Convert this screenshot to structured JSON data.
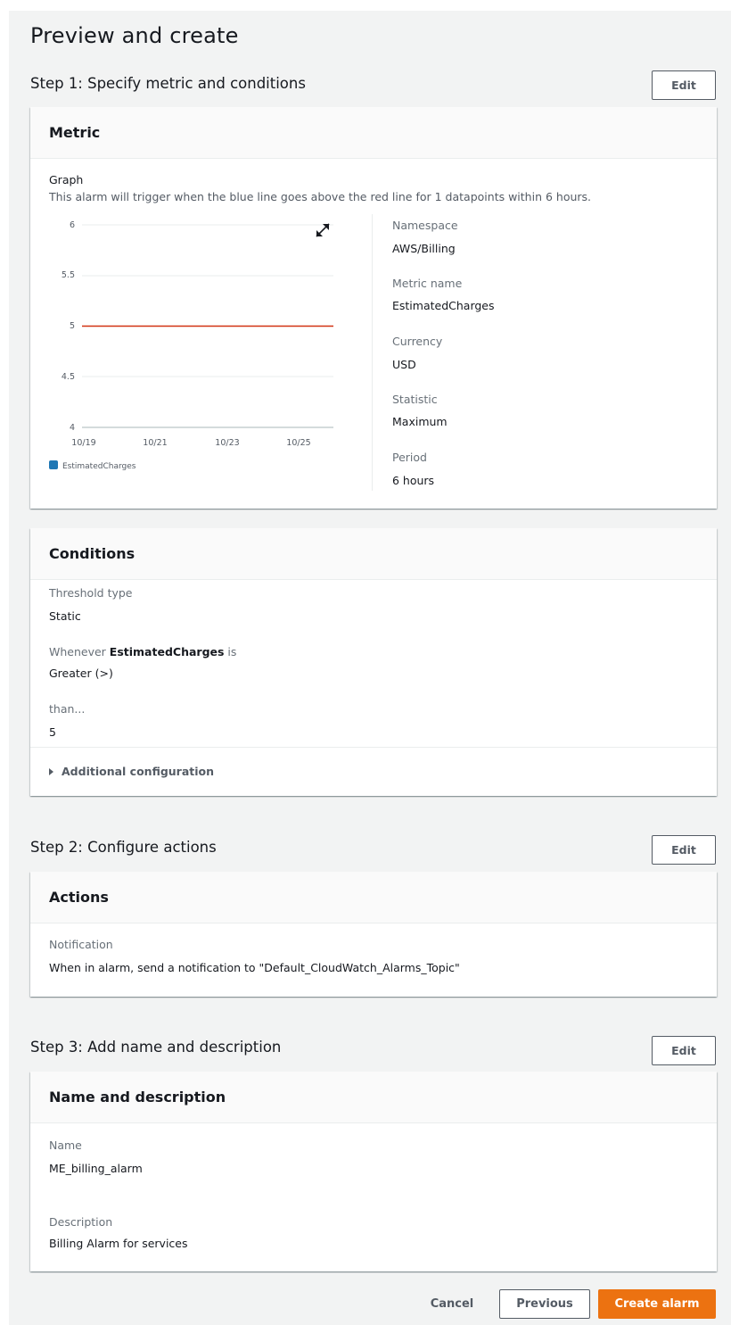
{
  "page": {
    "title": "Preview and create"
  },
  "step1": {
    "title": "Step 1: Specify metric and conditions",
    "edit_label": "Edit",
    "metric": {
      "heading": "Metric",
      "graph_label": "Graph",
      "graph_desc": "This alarm will trigger when the blue line goes above the red line for 1 datapoints within 6 hours.",
      "details": [
        {
          "label": "Namespace",
          "value": "AWS/Billing"
        },
        {
          "label": "Metric name",
          "value": "EstimatedCharges"
        },
        {
          "label": "Currency",
          "value": "USD"
        },
        {
          "label": "Statistic",
          "value": "Maximum"
        },
        {
          "label": "Period",
          "value": "6 hours"
        }
      ]
    },
    "conditions": {
      "heading": "Conditions",
      "threshold_type_label": "Threshold type",
      "threshold_type_value": "Static",
      "whenever_prefix": "Whenever ",
      "whenever_metric": "EstimatedCharges",
      "whenever_suffix": " is",
      "operator_value": "Greater (>)",
      "than_label": "than...",
      "than_value": "5",
      "additional_config": "Additional configuration"
    }
  },
  "chart_data": {
    "type": "line",
    "x_ticks": [
      "10/19",
      "10/21",
      "10/23",
      "10/25"
    ],
    "y_ticks": [
      "6",
      "5.5",
      "5",
      "4.5",
      "4"
    ],
    "ylim": [
      4,
      6
    ],
    "threshold": 5,
    "series": [
      {
        "name": "EstimatedCharges",
        "color": "#1f77b4",
        "values": []
      }
    ],
    "threshold_color": "#d13212",
    "legend_position": "bottom-left"
  },
  "step2": {
    "title": "Step 2: Configure actions",
    "edit_label": "Edit",
    "heading": "Actions",
    "notification_label": "Notification",
    "notification_value": "When in alarm, send a notification to \"Default_CloudWatch_Alarms_Topic\""
  },
  "step3": {
    "title": "Step 3: Add name and description",
    "edit_label": "Edit",
    "heading": "Name and description",
    "name_label": "Name",
    "name_value": "ME_billing_alarm",
    "description_label": "Description",
    "description_value": "Billing Alarm for services"
  },
  "footer": {
    "cancel_label": "Cancel",
    "previous_label": "Previous",
    "create_label": "Create alarm",
    "create_color": "#ec7211"
  }
}
